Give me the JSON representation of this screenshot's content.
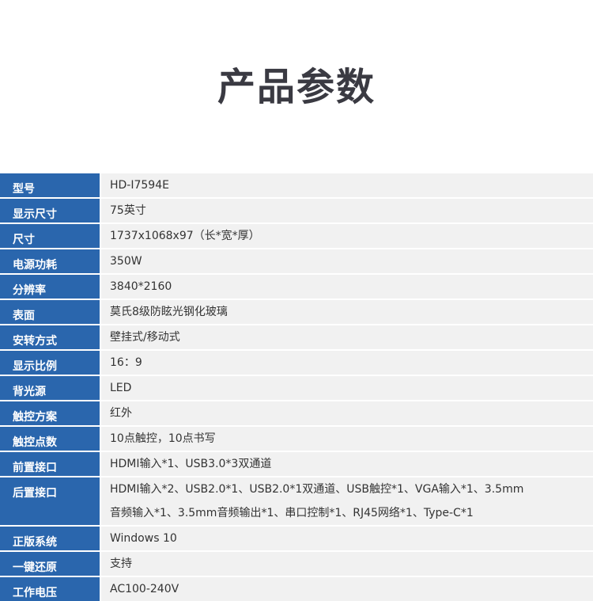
{
  "title": "产品参数",
  "specs": [
    {
      "label": "型号",
      "value": [
        "HD-I7594E"
      ]
    },
    {
      "label": "显示尺寸",
      "value": [
        "75英寸"
      ]
    },
    {
      "label": "尺寸",
      "value": [
        "1737x1068x97（长*宽*厚）"
      ]
    },
    {
      "label": "电源功耗",
      "value": [
        "350W"
      ]
    },
    {
      "label": "分辨率",
      "value": [
        "3840*2160"
      ]
    },
    {
      "label": "表面",
      "value": [
        "莫氏8级防眩光钢化玻璃"
      ]
    },
    {
      "label": "安转方式",
      "value": [
        "壁挂式/移动式"
      ]
    },
    {
      "label": "显示比例",
      "value": [
        "16：9"
      ]
    },
    {
      "label": "背光源",
      "value": [
        "LED"
      ]
    },
    {
      "label": "触控方案",
      "value": [
        "红外"
      ]
    },
    {
      "label": "触控点数",
      "value": [
        "10点触控，10点书写"
      ]
    },
    {
      "label": "前置接口",
      "value": [
        "HDMI输入*1、USB3.0*3双通道"
      ]
    },
    {
      "label": "后置接口",
      "value": [
        "HDMI输入*2、USB2.0*1、USB2.0*1双通道、USB触控*1、VGA输入*1、3.5mm",
        "音频输入*1、3.5mm音频输出*1、串口控制*1、RJ45网络*1、Type-C*1"
      ]
    },
    {
      "label": "正版系统",
      "value": [
        "Windows 10"
      ]
    },
    {
      "label": "一键还原",
      "value": [
        "支持"
      ]
    },
    {
      "label": "工作电压",
      "value": [
        "AC100-240V"
      ]
    }
  ]
}
